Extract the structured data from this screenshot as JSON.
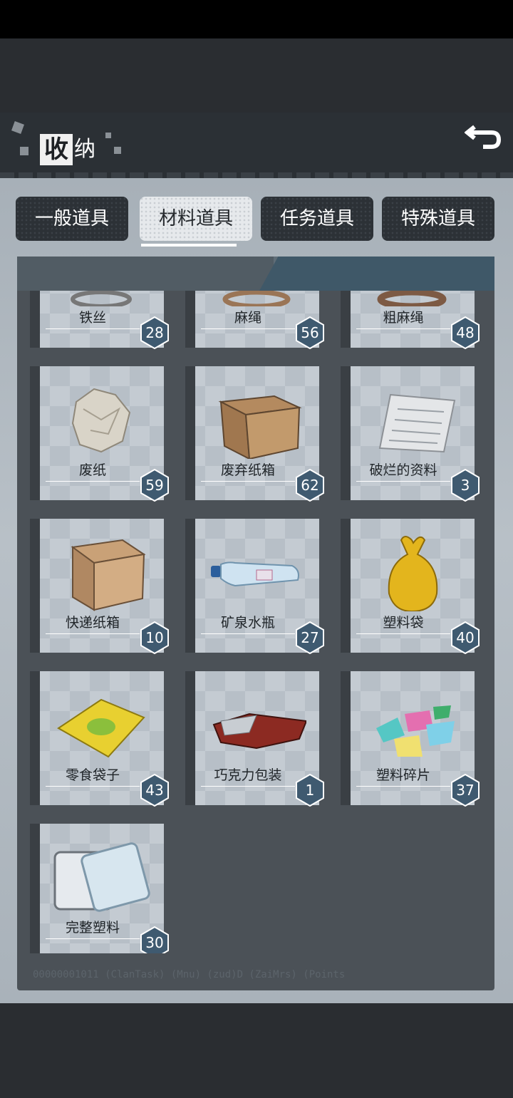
{
  "header": {
    "title_first": "收",
    "title_rest": "纳",
    "back_icon": "return-arrow-icon"
  },
  "tabs": [
    {
      "label": "一般道具",
      "active": false
    },
    {
      "label": "材料道具",
      "active": true
    },
    {
      "label": "任务道具",
      "active": false
    },
    {
      "label": "特殊道具",
      "active": false
    }
  ],
  "items": [
    {
      "name": "铁丝",
      "count": "28",
      "icon": "wire-icon"
    },
    {
      "name": "麻绳",
      "count": "56",
      "icon": "rope-icon"
    },
    {
      "name": "粗麻绳",
      "count": "48",
      "icon": "thick-rope-icon"
    },
    {
      "name": "废纸",
      "count": "59",
      "icon": "crumpled-paper-icon"
    },
    {
      "name": "废弃纸箱",
      "count": "62",
      "icon": "old-cardboard-box-icon"
    },
    {
      "name": "破烂的资料",
      "count": "3",
      "icon": "torn-documents-icon"
    },
    {
      "name": "快递纸箱",
      "count": "10",
      "icon": "shipping-box-icon"
    },
    {
      "name": "矿泉水瓶",
      "count": "27",
      "icon": "water-bottle-icon"
    },
    {
      "name": "塑料袋",
      "count": "40",
      "icon": "plastic-bag-icon"
    },
    {
      "name": "零食袋子",
      "count": "43",
      "icon": "snack-bag-icon"
    },
    {
      "name": "巧克力包装",
      "count": "1",
      "icon": "chocolate-wrapper-icon"
    },
    {
      "name": "塑料碎片",
      "count": "37",
      "icon": "plastic-shards-icon"
    },
    {
      "name": "完整塑料",
      "count": "30",
      "icon": "plastic-container-icon"
    }
  ],
  "footer": {
    "debug_text": "00000001011      (ClanTask) (Mnu)  (zud)D   (ZaiMrs)  (Points"
  },
  "colors": {
    "badge": "#3f5a70",
    "card": "#c4cbd2",
    "panel": "#4b5157"
  }
}
